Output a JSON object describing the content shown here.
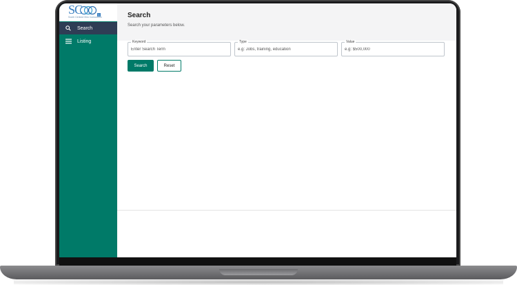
{
  "app": {
    "logo": {
      "text": "SC",
      "subtitle": "South Central Ohio Consortium",
      "badge": "1"
    }
  },
  "sidebar": {
    "items": [
      {
        "label": "Search",
        "icon": "search-icon",
        "active": true
      },
      {
        "label": "Listing",
        "icon": "menu-icon",
        "active": false
      }
    ]
  },
  "page": {
    "title": "Search",
    "subtitle": "Search your parameters below."
  },
  "form": {
    "keyword": {
      "label": "Keyword",
      "placeholder": "Enter Search Term"
    },
    "type": {
      "label": "Type",
      "placeholder": "e.g: Jobs, training, education"
    },
    "value": {
      "label": "Value",
      "placeholder": "e.g: $500,000"
    },
    "search_button": "Search",
    "reset_button": "Reset"
  },
  "colors": {
    "sidebar": "#007a68",
    "active_nav": "#2f3d55",
    "primary_button": "#007a68"
  }
}
